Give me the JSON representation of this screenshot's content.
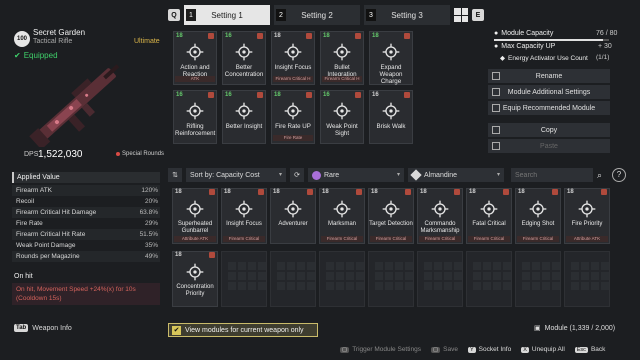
{
  "tabs": {
    "left_key": "Q",
    "right_key": "E",
    "items": [
      {
        "num": "1",
        "label": "Setting 1"
      },
      {
        "num": "2",
        "label": "Setting 2"
      },
      {
        "num": "3",
        "label": "Setting 3"
      }
    ]
  },
  "weapon": {
    "level": "100",
    "name": "Secret Garden",
    "type": "Tactical Rifle",
    "rarity": "Ultimate",
    "equipped": "Equipped",
    "dps_label": "DPS",
    "dps": "1,522,030",
    "ammo": "Special Rounds"
  },
  "stats": {
    "title": "Applied Value",
    "rows": [
      {
        "name": "Firearm ATK",
        "value": "120%"
      },
      {
        "name": "Recoil",
        "value": "20%"
      },
      {
        "name": "Firearm Critical Hit Damage",
        "value": "63.8%"
      },
      {
        "name": "Fire Rate",
        "value": "29%"
      },
      {
        "name": "Firearm Critical Hit Rate",
        "value": "51.5%"
      },
      {
        "name": "Weak Point Damage",
        "value": "35%"
      },
      {
        "name": "Rounds per Magazine",
        "value": "49%"
      }
    ],
    "onhit_title": "On hit",
    "onhit_text": "On hit, Movement Speed +24%(x) for 10s (Cooldown 15s)"
  },
  "weapon_info": {
    "key": "Tab",
    "label": "Weapon Info"
  },
  "equipped_modules": [
    {
      "socket": "18",
      "label": "Action and Reaction",
      "tag": "ATK",
      "socket_color": "green"
    },
    {
      "socket": "16",
      "label": "Better Concentration",
      "tag": "",
      "socket_color": "green"
    },
    {
      "socket": "18",
      "label": "Insight Focus",
      "tag": "Firearm Critical H",
      "socket_color": "grey"
    },
    {
      "socket": "18",
      "label": "Bullet Integration",
      "tag": "Firearm Critical H",
      "socket_color": "green"
    },
    {
      "socket": "18",
      "label": "Expand Weapon Charge",
      "tag": "",
      "socket_color": "green"
    },
    {
      "socket": "16",
      "label": "Rifling Reinforcement",
      "tag": "",
      "socket_color": "green"
    },
    {
      "socket": "16",
      "label": "Better Insight",
      "tag": "",
      "socket_color": "green"
    },
    {
      "socket": "18",
      "label": "Fire Rate UP",
      "tag": "Fire Rate",
      "socket_color": "green"
    },
    {
      "socket": "16",
      "label": "Weak Point Sight",
      "tag": "",
      "socket_color": "green"
    },
    {
      "socket": "16",
      "label": "Brisk Walk",
      "tag": "",
      "socket_color": "grey"
    }
  ],
  "capacity": {
    "label": "Module Capacity",
    "value": "76 / 80",
    "max_label": "Max Capacity UP",
    "max_value": "+ 30",
    "activator_label": "Energy Activator Use Count",
    "activator_value": "(1/1)"
  },
  "actions": [
    {
      "label": "Rename",
      "enabled": true
    },
    {
      "label": "Module Additional Settings",
      "enabled": true
    },
    {
      "label": "Equip Recommended Module",
      "enabled": true
    },
    {
      "label": "Copy",
      "enabled": true
    },
    {
      "label": "Paste",
      "enabled": false
    }
  ],
  "filters": {
    "sort": "Sort by: Capacity Cost",
    "rarity": "Rare",
    "socket": "Almandine",
    "search_placeholder": "Search",
    "help": "?"
  },
  "inventory": [
    {
      "socket": "18",
      "label": "Superheated Gunbarrel",
      "tag": "Attribute ATK",
      "socket_color": "grey"
    },
    {
      "socket": "18",
      "label": "Insight Focus",
      "tag": "Firearm Critical",
      "socket_color": "grey"
    },
    {
      "socket": "18",
      "label": "Adventurer",
      "tag": "",
      "socket_color": "grey"
    },
    {
      "socket": "18",
      "label": "Marksman",
      "tag": "Firearm Critical",
      "socket_color": "grey"
    },
    {
      "socket": "18",
      "label": "Target Detection",
      "tag": "Firearm Critical",
      "socket_color": "grey"
    },
    {
      "socket": "18",
      "label": "Commando Marksmanship",
      "tag": "Firearm Critical",
      "socket_color": "grey"
    },
    {
      "socket": "18",
      "label": "Fatal Critical",
      "tag": "Firearm Critical",
      "socket_color": "grey"
    },
    {
      "socket": "18",
      "label": "Edging Shot",
      "tag": "Firearm Critical",
      "socket_color": "grey"
    },
    {
      "socket": "18",
      "label": "Fire Priority",
      "tag": "Attribute ATK",
      "socket_color": "grey"
    },
    {
      "socket": "18",
      "label": "Concentration Priority",
      "tag": "",
      "socket_color": "grey"
    }
  ],
  "view_only": "View modules for current weapon only",
  "module_count": "Module (1,339 / 2,000)",
  "bottom_bar": [
    {
      "key": "",
      "label": "Trigger Module Settings",
      "on": false
    },
    {
      "key": "",
      "label": "Save",
      "on": false
    },
    {
      "key": "Y",
      "label": "Socket Info",
      "on": true
    },
    {
      "key": "X",
      "label": "Unequip All",
      "on": true
    },
    {
      "key": "Esc",
      "label": "Back",
      "on": true
    }
  ],
  "colors": {
    "accent": "#d7c65a",
    "equipped": "#3fcf6a",
    "ultimate": "#d9b449",
    "attack_tag": "#d94b45"
  }
}
